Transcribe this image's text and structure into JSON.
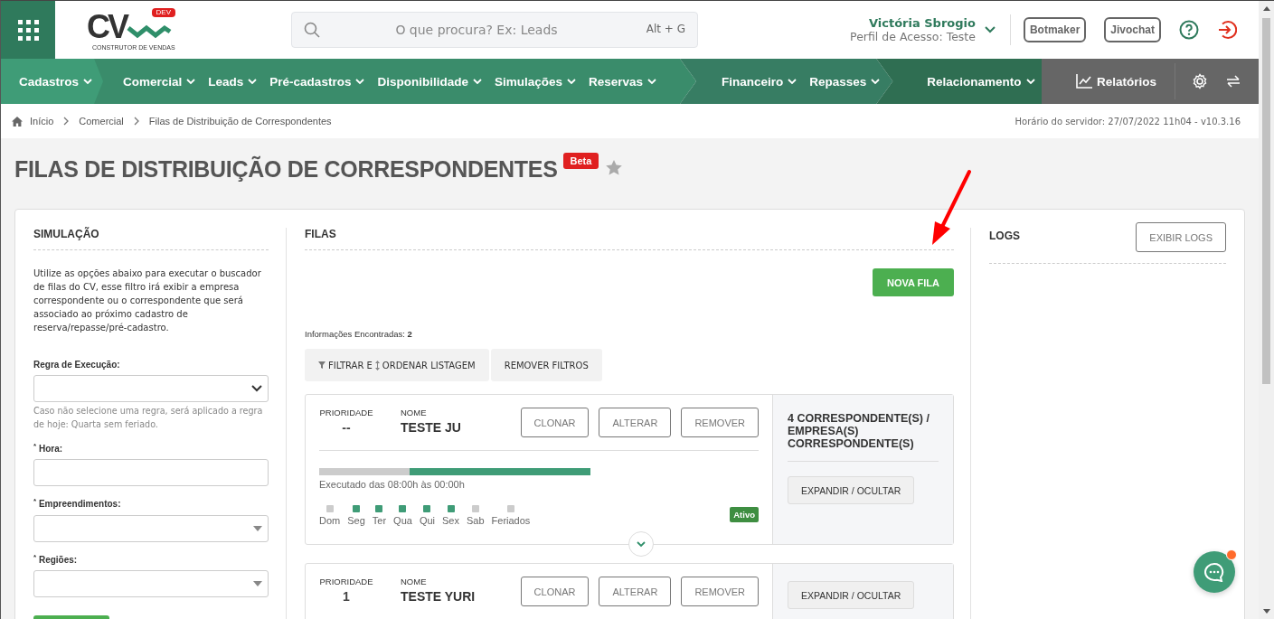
{
  "header": {
    "logo": {
      "letters": "CV",
      "badge": "DEV",
      "tagline": "CONSTRUTOR DE VENDAS"
    },
    "search_placeholder": "O que procura? Ex: Leads",
    "shortcut": "Alt + G",
    "user_name": "Victória Sbrogio",
    "user_profile": "Perfil de Acesso: Teste",
    "buttons": [
      "Botmaker",
      "Jivochat"
    ]
  },
  "nav": {
    "groups": [
      {
        "items": [
          "Cadastros"
        ]
      },
      {
        "items": [
          "Comercial",
          "Leads",
          "Pré-cadastros",
          "Disponibilidade",
          "Simulações",
          "Reservas"
        ]
      },
      {
        "items": [
          "Financeiro",
          "Repasses"
        ]
      },
      {
        "items": [
          "Relacionamento"
        ]
      }
    ],
    "reports": "Relatórios"
  },
  "breadcrumb": {
    "items": [
      "Início",
      "Comercial",
      "Filas de Distribuição de Correspondentes"
    ],
    "server_time": "Horário do servidor: 27/07/2022 11h04 - v10.3.16"
  },
  "page": {
    "title": "FILAS DE DISTRIBUIÇÃO DE CORRESPONDENTES",
    "badge": "Beta"
  },
  "simulation": {
    "heading": "SIMULAÇÃO",
    "description": "Utilize as opções abaixo para executar o buscador de filas do CV, esse filtro irá exibir a empresa correspondente ou o correspondente que será associado ao próximo cadastro de reserva/repasse/pré-cadastro.",
    "fields": [
      {
        "label": "Regra de Execução:",
        "kind": "select",
        "hint": "Caso não selecione uma regra, será aplicado a regra de hoje: Quarta sem feriado."
      },
      {
        "label": "$^{*}$ Hora:",
        "kind": "text"
      },
      {
        "label": "$^{*}$ Empreendimentos:",
        "kind": "combo"
      },
      {
        "label": "$^{*}$ Regiões:",
        "kind": "combo"
      }
    ]
  },
  "queues_panel": {
    "heading": "FILAS",
    "new_button": "NOVA FILA",
    "found": "Informações Encontradas: **2**",
    "filter_button": {
      "before": "FILTRAR E",
      "after": "ORDENAR LISTAGEM"
    },
    "remove_filters": "REMOVER FILTROS",
    "queues": [
      {
        "priority_label": "PRIORIDADE",
        "priority": "--",
        "name_label": "NOME",
        "name": "TESTE JU",
        "actions": [
          "CLONAR",
          "ALTERAR",
          "REMOVER"
        ],
        "schedule": {
          "level": 0.667,
          "text": "Executado das 08:00h às 00:00h"
        },
        "days": [
          {
            "label": "Dom",
            "on": false
          },
          {
            "label": "Seg",
            "on": true
          },
          {
            "label": "Ter",
            "on": true
          },
          {
            "label": "Qua",
            "on": true
          },
          {
            "label": "Qui",
            "on": true
          },
          {
            "label": "Sex",
            "on": true
          },
          {
            "label": "Sab",
            "on": false
          },
          {
            "label": "Feriados",
            "on": false
          }
        ],
        "status": "Ativo",
        "summary": "4 CORRESPONDENTE(S) / EMPRESA(S) CORRESPONDENTE(S)",
        "expand_button": "EXPANDIR / OCULTAR"
      },
      {
        "priority_label": "PRIORIDADE",
        "priority": "1",
        "name_label": "NOME",
        "name": "TESTE YURI",
        "actions": [
          "CLONAR",
          "ALTERAR",
          "REMOVER"
        ],
        "expand_button": "EXPANDIR / OCULTAR"
      }
    ]
  },
  "logs": {
    "heading": "LOGS",
    "button": "EXIBIR LOGS"
  }
}
